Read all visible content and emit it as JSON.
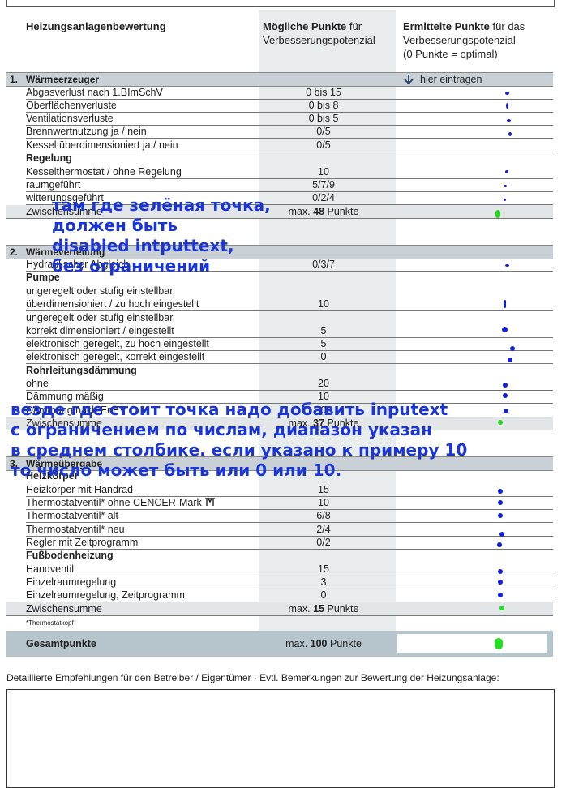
{
  "header": {
    "col1": "Heizungsanlagenbewertung",
    "col2_bold": "Mögliche Punkte",
    "col2_rest": " für",
    "col2_line2": "Verbesserungspotenzial",
    "col3_bold": "Ermittelte Punkte",
    "col3_rest": " für das",
    "col3_line2": "Verbesserungspotenzial",
    "col3_line3": "(0 Punkte = optimal)"
  },
  "sections": {
    "s1": {
      "num": "1.",
      "label": "Wärmeerzeuger",
      "hint": "hier eintragen"
    },
    "s2": {
      "num": "2.",
      "label": "Wärmeverteilung"
    },
    "s3": {
      "num": "3.",
      "label": "Wärmeübergabe"
    }
  },
  "rows": {
    "r1": {
      "label": "Abgasverlust nach 1.BImSchV",
      "value": "0 bis 15"
    },
    "r2": {
      "label": "Oberflächenverluste",
      "value": "0 bis 8"
    },
    "r3": {
      "label": "Ventilationsverluste",
      "value": "0 bis 5"
    },
    "r4": {
      "label": "Brennwertnutzung ja / nein",
      "value": "0/5"
    },
    "r5": {
      "label": "Kessel überdimensioniert ja / nein",
      "value": "0/5"
    },
    "r6": {
      "label": "Regelung"
    },
    "r7": {
      "label": "Kesselthermostat / ohne Regelung",
      "value": "10"
    },
    "r8": {
      "label": "raumgeführt",
      "value": "5/7/9"
    },
    "r9": {
      "label": "witterungsgeführt",
      "value": "0/2/4"
    },
    "r10": {
      "label": "Zwischensumme",
      "value_prefix": "max.",
      "value_num": "48",
      "value_suffix": "Punkte"
    },
    "r11": {
      "label": "Hydraulischer Abgleich",
      "value": "0/3/7"
    },
    "r12": {
      "label": "Pumpe"
    },
    "r13a": {
      "label": "ungeregelt oder stufig einstellbar,"
    },
    "r13b": {
      "label": "überdimensioniert / zu hoch eingestellt",
      "value": "10"
    },
    "r14a": {
      "label": "ungeregelt oder stufig einstellbar,"
    },
    "r14b": {
      "label": "korrekt dimensioniert / eingestellt",
      "value": "5"
    },
    "r15": {
      "label": "elektronisch geregelt, zu hoch eingestellt",
      "value": "5"
    },
    "r16": {
      "label": "elektronisch geregelt, korrekt eingestellt",
      "value": "0"
    },
    "r17": {
      "label": "Rohrleitungsdämmung"
    },
    "r18": {
      "label": "ohne",
      "value": "20"
    },
    "r19": {
      "label": "Dämmung mäßig",
      "value": "10"
    },
    "r20": {
      "label": "Dämmung nach EnEV",
      "value": "0"
    },
    "r21": {
      "label": "Zwischensumme",
      "value_prefix": "max.",
      "value_num": "37",
      "value_suffix": "Punkte"
    },
    "r22": {
      "label": "Heizkörper"
    },
    "r23": {
      "label": "Heizkörper mit Handrad",
      "value": "15"
    },
    "r24": {
      "label": "Thermostatventil* ohne CENCER-Mark",
      "value": "10"
    },
    "r25": {
      "label": "Thermostatventil* alt",
      "value": "6/8"
    },
    "r26": {
      "label": "Thermostatventil* neu",
      "value": "2/4"
    },
    "r27": {
      "label": "Regler mit Zeitprogramm",
      "value": "0/2"
    },
    "r28": {
      "label": "Fußbodenheizung"
    },
    "r29": {
      "label": "Handventil",
      "value": "15"
    },
    "r30": {
      "label": "Einzelraumregelung",
      "value": "3"
    },
    "r31": {
      "label": "Einzelraumregelung, Zeitprogramm",
      "value": "0"
    },
    "r32": {
      "label": "Zwischensumme",
      "value_prefix": "max.",
      "value_num": "15",
      "value_suffix": "Punkte"
    }
  },
  "footnote": "*Thermostatkopf",
  "total": {
    "label": "Gesamtpunkte",
    "value_prefix": "max.",
    "value_num": "100",
    "value_suffix": "Punkte"
  },
  "recommendation": "Detaillierte Empfehlungen für den Betreiber / Eigentümer · Evtl. Bemerkungen zur Bewertung der Heizungsanlage:",
  "annotations": {
    "a1_l1": "там где зелёная точка,",
    "a1_l2": "должен быть",
    "a1_l3": "disabled intputtext,",
    "a1_l4": "без ограничений",
    "a2_l1": "везде где стоит точка надо добавить inputext",
    "a2_l2": "с ограничением по числам, диапазон указан",
    "a2_l3": "в среднем столбике. если указано к примеру 10",
    "a2_l4": "то число может быть или 0 или 10."
  },
  "colors": {
    "dot_blue": "#1020d8",
    "dot_green": "#22dd22",
    "annotation": "#1a35d6"
  }
}
